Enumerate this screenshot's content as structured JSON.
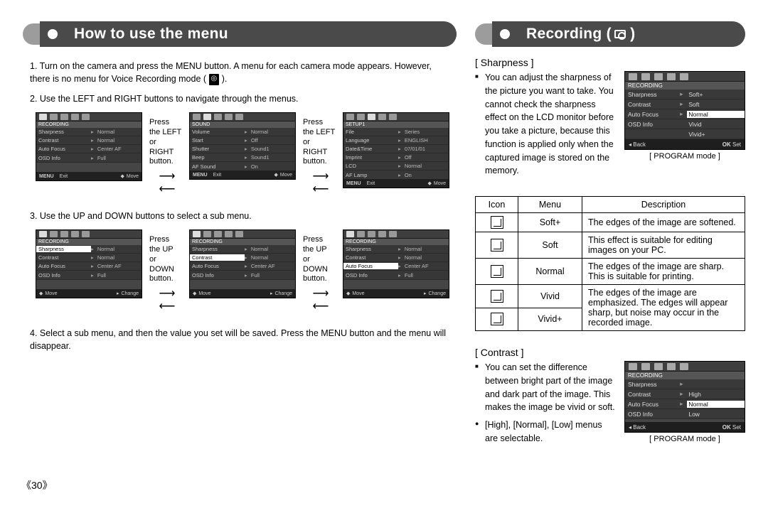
{
  "left": {
    "title": "How to use the menu",
    "steps": [
      "1. Turn on the camera and press the MENU button. A menu for each camera mode appears. However, there is no menu for Voice Recording mode (",
      "2. Use the LEFT and RIGHT buttons to navigate through the menus.",
      "3. Use the UP and DOWN buttons to select a sub menu.",
      "4. Select a sub menu, and then the value you set will be saved. Press the MENU button and the menu will disappear."
    ],
    "step1_tail": " ).",
    "cap_lr": "Press the LEFT or RIGHT button.",
    "cap_ud": "Press the UP or DOWN button.",
    "lcd_recording": {
      "cat": "RECORDING",
      "rows": [
        {
          "k": "Sharpness",
          "v": "Normal"
        },
        {
          "k": "Contrast",
          "v": "Normal"
        },
        {
          "k": "Auto Focus",
          "v": "Center AF"
        },
        {
          "k": "OSD Info",
          "v": "Full"
        }
      ],
      "bot_l_menu": "MENU",
      "bot_l": "Exit",
      "bot_r": "Move"
    },
    "lcd_recording_move": {
      "bot_l": "Move",
      "bot_r": "Change"
    },
    "lcd_sound": {
      "cat": "SOUND",
      "rows": [
        {
          "k": "Volume",
          "v": "Normal"
        },
        {
          "k": "Start",
          "v": "Off"
        },
        {
          "k": "Shutter",
          "v": "Sound1"
        },
        {
          "k": "Beep",
          "v": "Sound1"
        },
        {
          "k": "AF Sound",
          "v": "On"
        }
      ]
    },
    "lcd_setup1": {
      "cat": "SETUP1",
      "rows": [
        {
          "k": "File",
          "v": "Series"
        },
        {
          "k": "Language",
          "v": "ENGLISH"
        },
        {
          "k": "Date&Time",
          "v": "07/01/01"
        },
        {
          "k": "Imprint",
          "v": "Off"
        },
        {
          "k": "LCD",
          "v": "Normal"
        },
        {
          "k": "AF Lamp",
          "v": "On"
        }
      ]
    }
  },
  "right": {
    "title": "Recording (",
    "sharpness": {
      "heading": "[ Sharpness ]",
      "text": "You can adjust the sharpness of the picture you want to take. You cannot check the sharpness effect on the LCD monitor before you take a picture, because this function is applied only when the captured image is stored on the memory.",
      "mode_cap": "[ PROGRAM mode ]",
      "lcd": {
        "cat": "RECORDING",
        "rows": [
          {
            "k": "Sharpness",
            "v": "Soft+"
          },
          {
            "k": "Contrast",
            "v": "Soft"
          },
          {
            "k": "Auto Focus",
            "v": "Normal",
            "hl": true
          },
          {
            "k": "OSD Info",
            "v": "Vivid"
          },
          {
            "k": "",
            "v": "Vivid+"
          }
        ],
        "back": "Back",
        "ok": "OK",
        "set": "Set"
      },
      "table": {
        "head": [
          "Icon",
          "Menu",
          "Description"
        ],
        "rows": [
          {
            "menu": "Soft+",
            "desc": "The edges of the image are softened."
          },
          {
            "menu": "Soft",
            "desc": "This effect is suitable for editing images on your PC."
          },
          {
            "menu": "Normal",
            "desc": "The edges of the image are sharp.\nThis is suitable for printing."
          },
          {
            "menu": "Vivid",
            "desc_a": "The edges of the image are emphasized. The edges"
          },
          {
            "menu": "Vivid+",
            "desc_b": "will appear sharp, but noise may occur in the recorded image."
          }
        ]
      }
    },
    "contrast": {
      "heading": "[ Contrast ]",
      "text": "You can set the difference between bright part of the image and dark part of the image. This makes the image be vivid or soft.",
      "text2": "[High], [Normal], [Low] menus are selectable.",
      "mode_cap": "[ PROGRAM mode ]",
      "lcd": {
        "cat": "RECORDING",
        "rows": [
          {
            "k": "Sharpness",
            "v": ""
          },
          {
            "k": "Contrast",
            "v": "High"
          },
          {
            "k": "Auto Focus",
            "v": "Normal",
            "hl": true
          },
          {
            "k": "OSD Info",
            "v": "Low"
          }
        ],
        "back": "Back",
        "ok": "OK",
        "set": "Set"
      }
    }
  },
  "pagenum": "《30》"
}
